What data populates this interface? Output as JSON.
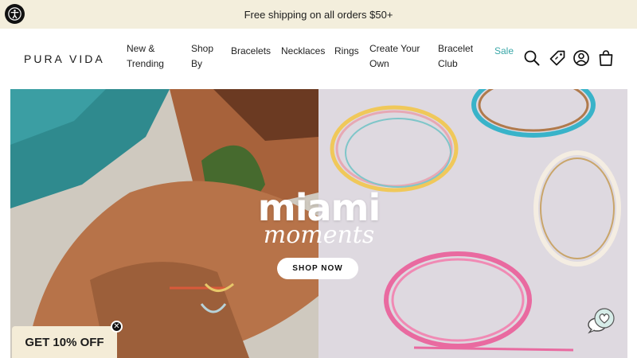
{
  "announcement": {
    "text": "Free shipping on all orders $50+"
  },
  "header": {
    "logo": "PURA VIDA",
    "nav": [
      {
        "label": "New & Trending"
      },
      {
        "label": "Shop By"
      },
      {
        "label": "Bracelets"
      },
      {
        "label": "Necklaces"
      },
      {
        "label": "Rings"
      },
      {
        "label": "Create Your Own"
      },
      {
        "label": "Bracelet Club"
      },
      {
        "label": "Sale"
      }
    ],
    "icons": [
      "search-icon",
      "rewards-tag-icon",
      "account-icon",
      "cart-bag-icon"
    ]
  },
  "hero": {
    "title": "miami",
    "subtitle": "moments",
    "cta": "SHOP NOW"
  },
  "promo": {
    "label": "GET 10% OFF",
    "close": "✕"
  },
  "colors": {
    "announce_bg": "#f3eedc",
    "sale": "#3aa7a8",
    "promo_bg": "#f4ecd7"
  }
}
